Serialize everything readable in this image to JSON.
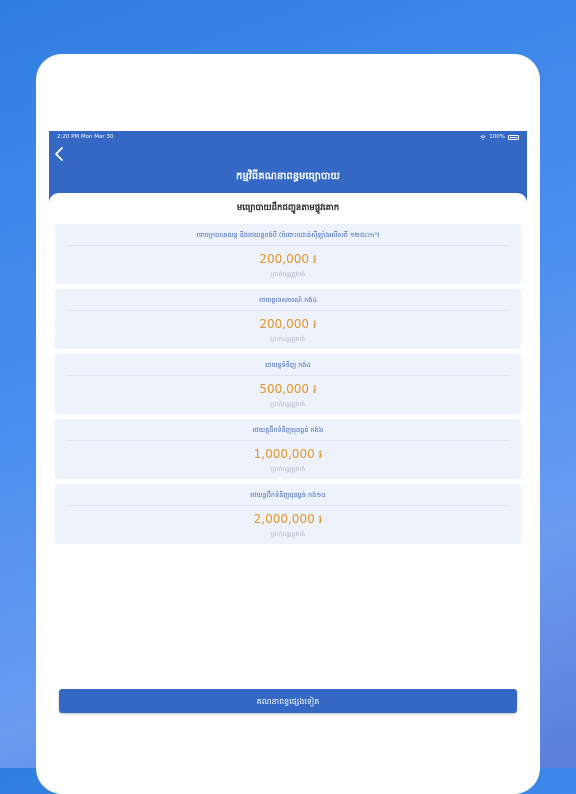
{
  "status_bar": {
    "time": "2:20 PM  Mon Mar 30",
    "battery": "100%"
  },
  "header": {
    "title": "កម្មវិធីគណនាពន្ធមធ្យោបាយ"
  },
  "section": {
    "title": "មធ្យោបាយដឹកជញ្ជូនតាមផ្លូវគោក"
  },
  "cards": [
    {
      "label": "ទោចក្រយានយន្ត និងរថយន្តកង់បី (ចំពោះបដាន់ស៊ីឡាំងលើសពី ១២៥cm³)",
      "amount": "200,000 ៛",
      "caption": "ប្រាក់ពន្ធត្រូវបង់"
    },
    {
      "label": "រថយន្តទេសចរណ៍ កង់៤",
      "amount": "200,000 ៛",
      "caption": "ប្រាក់ពន្ធត្រូវបង់"
    },
    {
      "label": "រថយន្តទំនិញ កង់៤",
      "amount": "500,000 ៛",
      "caption": "ប្រាក់ពន្ធត្រូវបង់"
    },
    {
      "label": "រថយន្តដឹកទំនិញធុនធ្ងន់ កង់៦",
      "amount": "1,000,000 ៛",
      "caption": "ប្រាក់ពន្ធត្រូវបង់"
    },
    {
      "label": "រថយន្តដឹកទំនិញធុនធ្ងន់ កង់១០",
      "amount": "2,000,000 ៛",
      "caption": "ប្រាក់ពន្ធត្រូវបង់"
    }
  ],
  "footer": {
    "button_label": "គណនាពន្ធផ្សេងទៀត"
  },
  "colors": {
    "header": "#3468c4",
    "amount": "#e0952a",
    "card_bg": "#eef3fb"
  }
}
